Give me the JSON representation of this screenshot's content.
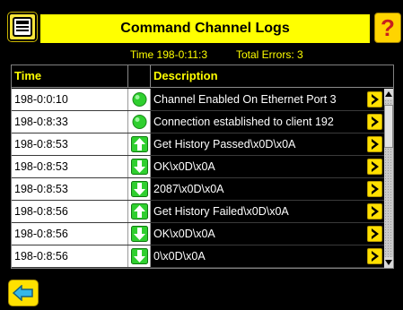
{
  "header": {
    "title": "Command Channel Logs",
    "help_label": "?"
  },
  "status": {
    "time": "Time 198-0:11:3",
    "errors": "Total Errors: 3"
  },
  "table": {
    "columns": [
      "Time",
      "",
      "Description"
    ],
    "rows": [
      {
        "time": "198-0:0:10",
        "icon": "green-dot-icon",
        "description": "Channel Enabled On Ethernet Port 3"
      },
      {
        "time": "198-0:8:33",
        "icon": "green-dot-icon",
        "description": "Connection established to client 192"
      },
      {
        "time": "198-0:8:53",
        "icon": "arrow-up-icon",
        "description": "Get History Passed\\x0D\\x0A"
      },
      {
        "time": "198-0:8:53",
        "icon": "arrow-down-icon",
        "description": "OK\\x0D\\x0A"
      },
      {
        "time": "198-0:8:53",
        "icon": "arrow-down-icon",
        "description": "2087\\x0D\\x0A"
      },
      {
        "time": "198-0:8:56",
        "icon": "arrow-up-icon",
        "description": "Get History Failed\\x0D\\x0A"
      },
      {
        "time": "198-0:8:56",
        "icon": "arrow-down-icon",
        "description": "OK\\x0D\\x0A"
      },
      {
        "time": "198-0:8:56",
        "icon": "arrow-down-icon",
        "description": "0\\x0D\\x0A"
      }
    ]
  },
  "colors": {
    "accent": "#ffff00",
    "background": "#000000",
    "green": "#2fcf2f"
  }
}
